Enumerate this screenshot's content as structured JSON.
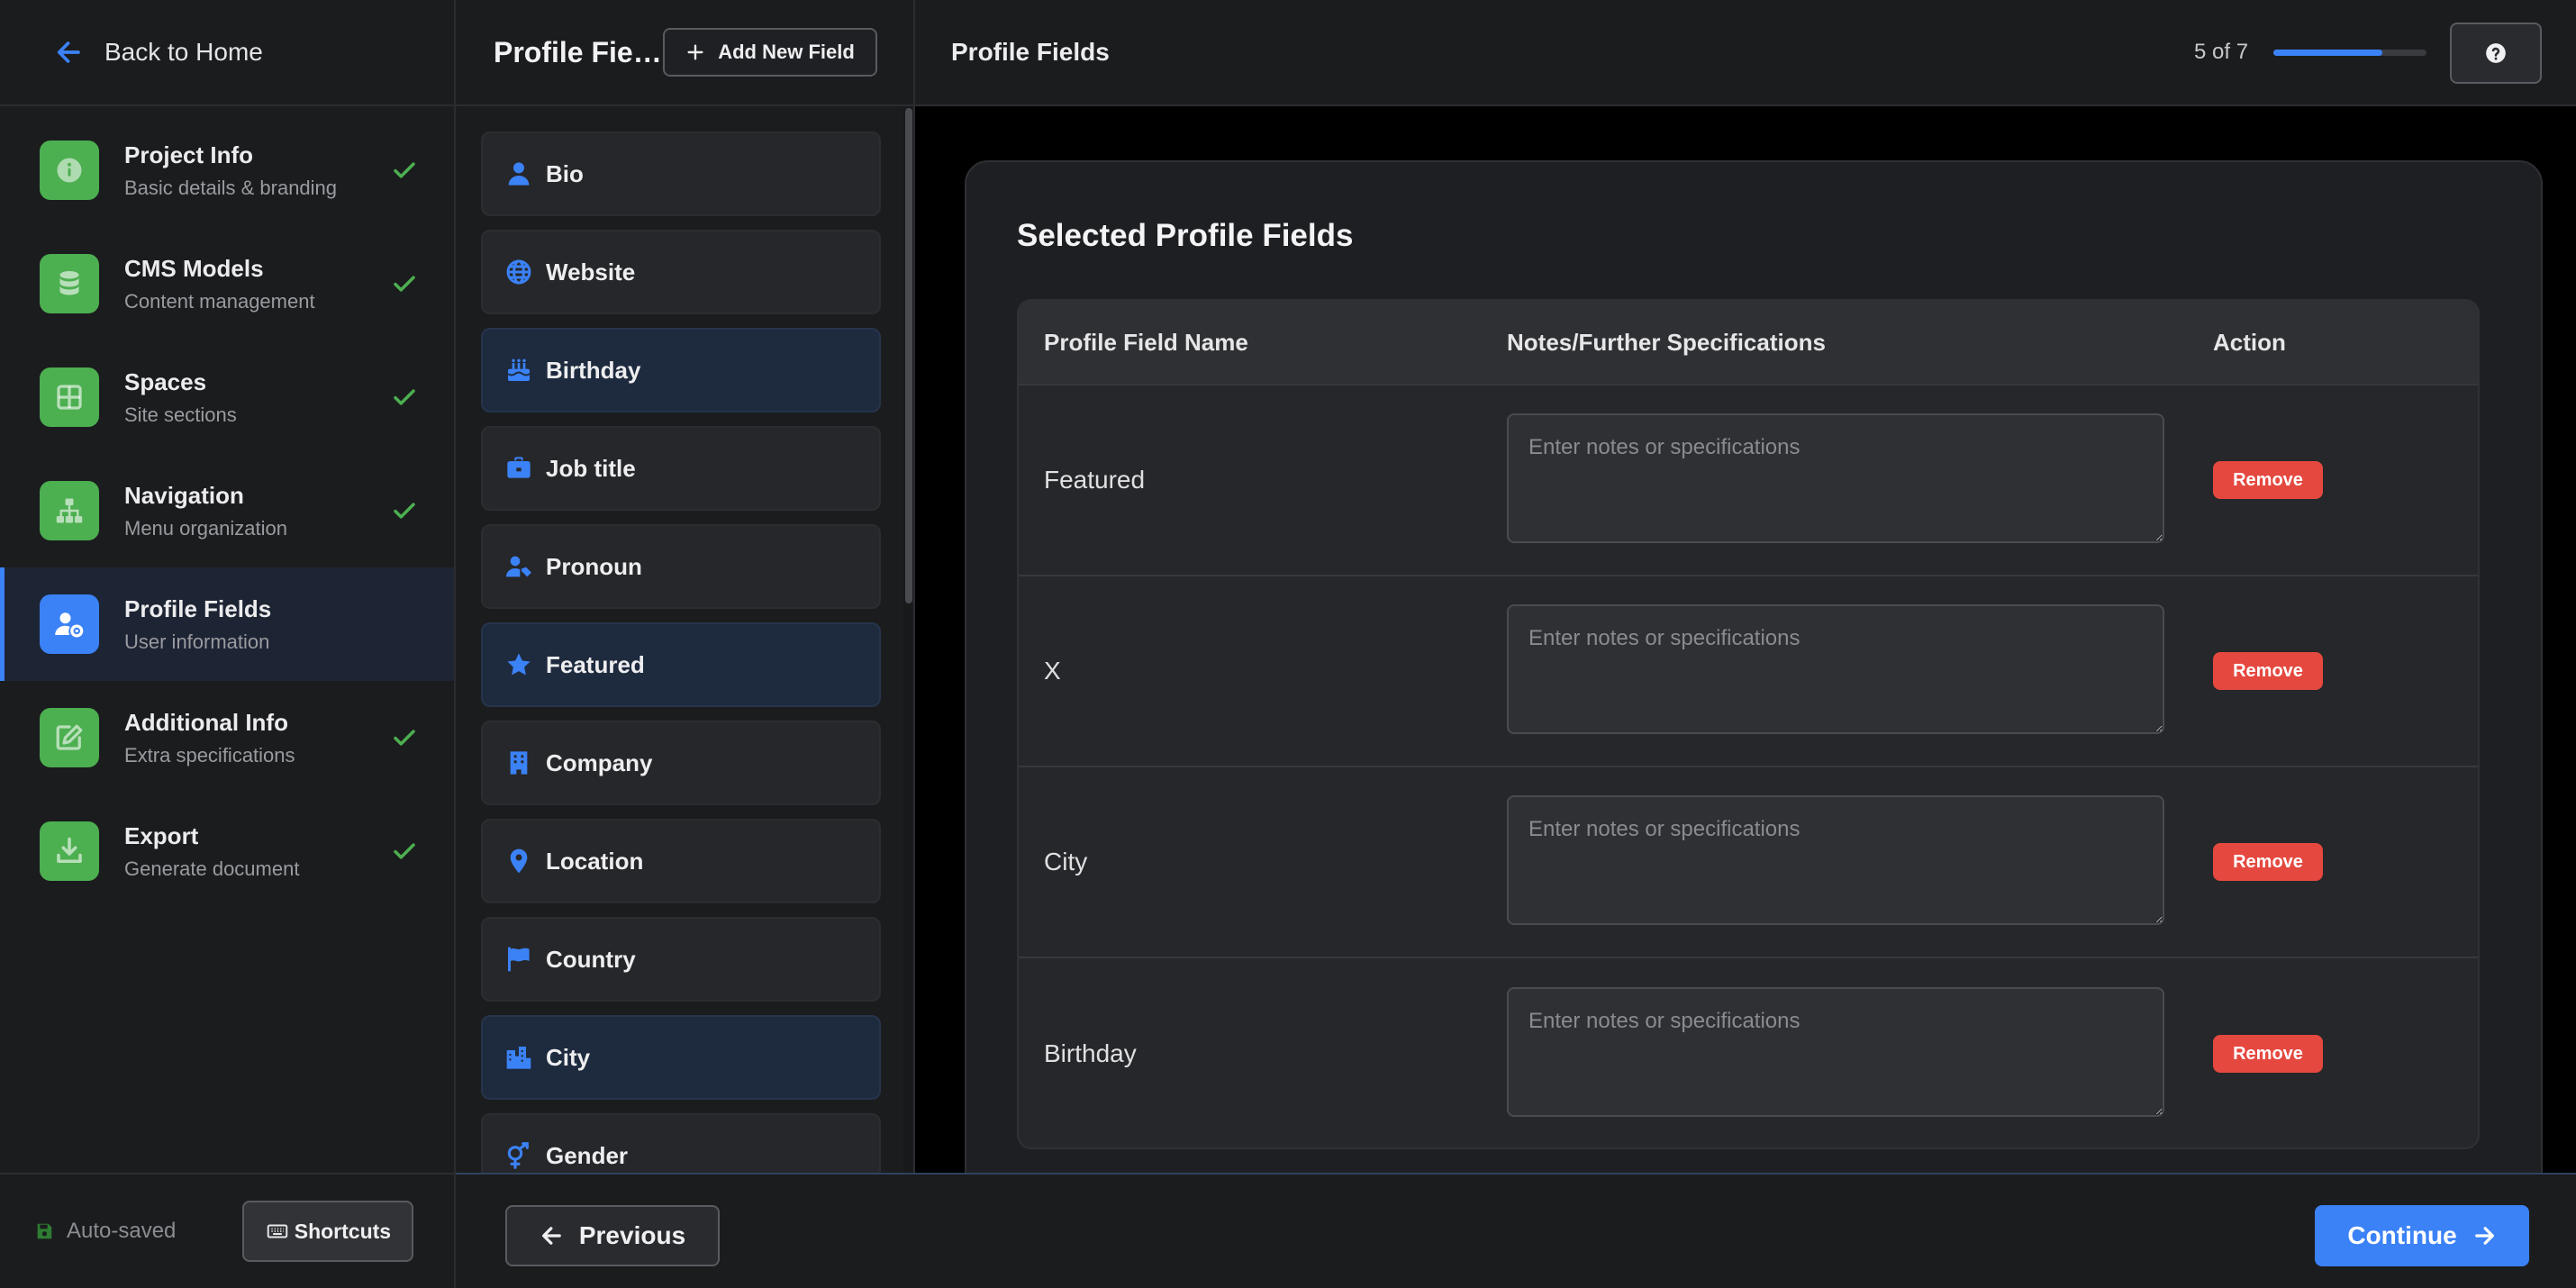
{
  "colors": {
    "accent": "#3b82f6",
    "success": "#4caf50",
    "danger": "#e5483f",
    "background": "#1b1c1e"
  },
  "sidebar": {
    "back_label": "Back to Home",
    "steps": [
      {
        "title": "Project Info",
        "subtitle": "Basic details & branding",
        "icon": "info-icon",
        "status": "complete"
      },
      {
        "title": "CMS Models",
        "subtitle": "Content management",
        "icon": "database-icon",
        "status": "complete"
      },
      {
        "title": "Spaces",
        "subtitle": "Site sections",
        "icon": "grid-icon",
        "status": "complete"
      },
      {
        "title": "Navigation",
        "subtitle": "Menu organization",
        "icon": "sitemap-icon",
        "status": "complete"
      },
      {
        "title": "Profile Fields",
        "subtitle": "User information",
        "icon": "user-gear-icon",
        "status": "active"
      },
      {
        "title": "Additional Info",
        "subtitle": "Extra specifications",
        "icon": "edit-icon",
        "status": "complete"
      },
      {
        "title": "Export",
        "subtitle": "Generate document",
        "icon": "download-icon",
        "status": "complete"
      }
    ],
    "autosave_label": "Auto-saved",
    "shortcuts_label": "Shortcuts"
  },
  "fields_panel": {
    "title": "Profile Fields",
    "add_button_label": "Add New Field",
    "items": [
      {
        "label": "Bio",
        "icon": "user-icon",
        "selected": false
      },
      {
        "label": "Website",
        "icon": "globe-icon",
        "selected": false
      },
      {
        "label": "Birthday",
        "icon": "cake-icon",
        "selected": true
      },
      {
        "label": "Job title",
        "icon": "briefcase-icon",
        "selected": false
      },
      {
        "label": "Pronoun",
        "icon": "user-tag-icon",
        "selected": false
      },
      {
        "label": "Featured",
        "icon": "star-icon",
        "selected": true
      },
      {
        "label": "Company",
        "icon": "building-icon",
        "selected": false
      },
      {
        "label": "Location",
        "icon": "map-pin-icon",
        "selected": false
      },
      {
        "label": "Country",
        "icon": "flag-icon",
        "selected": false
      },
      {
        "label": "City",
        "icon": "city-icon",
        "selected": true
      },
      {
        "label": "Gender",
        "icon": "gender-icon",
        "selected": false
      }
    ]
  },
  "header": {
    "title": "Profile Fields",
    "progress_text": "5 of 7",
    "progress_fraction": 0.714
  },
  "card": {
    "title": "Selected Profile Fields",
    "columns": [
      "Profile Field Name",
      "Notes/Further Specifications",
      "Action"
    ],
    "rows": [
      {
        "name": "Featured",
        "notes": "",
        "notes_placeholder": "Enter notes or specifications",
        "action_label": "Remove"
      },
      {
        "name": "X",
        "notes": "",
        "notes_placeholder": "Enter notes or specifications",
        "action_label": "Remove"
      },
      {
        "name": "City",
        "notes": "",
        "notes_placeholder": "Enter notes or specifications",
        "action_label": "Remove"
      },
      {
        "name": "Birthday",
        "notes": "",
        "notes_placeholder": "Enter notes or specifications",
        "action_label": "Remove"
      }
    ]
  },
  "footer": {
    "previous_label": "Previous",
    "continue_label": "Continue"
  }
}
